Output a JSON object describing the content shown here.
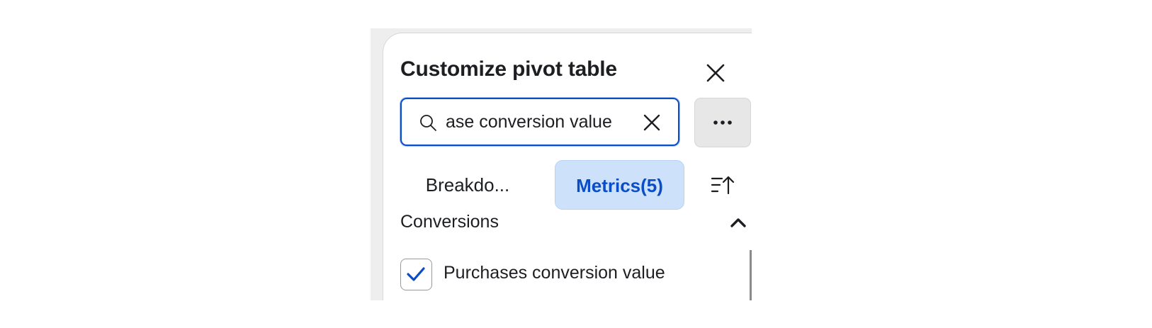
{
  "panel": {
    "title": "Customize pivot table"
  },
  "search": {
    "value": "ase conversion value"
  },
  "tabs": {
    "breakdowns_label": "Breakdo...",
    "metrics_label": "Metrics(5)",
    "active": "metrics"
  },
  "section": {
    "label": "Conversions",
    "expanded": true
  },
  "items": [
    {
      "label": "Purchases conversion value",
      "checked": true
    }
  ],
  "colors": {
    "accent": "#0a4ec7",
    "active_tab_bg": "#cde1fa",
    "text": "#1c1e21"
  },
  "icons": {
    "close": "close-icon",
    "search": "search-icon",
    "clear": "clear-icon",
    "more": "more-horizontal-icon",
    "sort": "sort-icon",
    "collapse": "chevron-up-icon",
    "check": "checkmark-icon"
  }
}
